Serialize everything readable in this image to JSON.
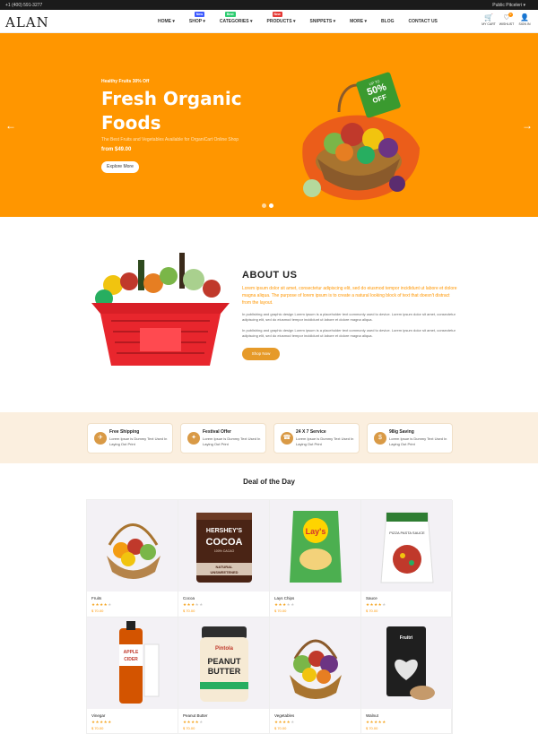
{
  "topbar": {
    "phone": "+1 (400) 591-3277",
    "public_profile": "Public Pitceleri"
  },
  "header": {
    "logo": "ALAN",
    "nav": [
      {
        "label": "HOME",
        "chev": true,
        "badge": null
      },
      {
        "label": "SHOP",
        "chev": true,
        "badge": "New",
        "badge_color": "#3d5afe"
      },
      {
        "label": "CATEGORIES",
        "chev": true,
        "badge": "Best",
        "badge_color": "#2ecc71"
      },
      {
        "label": "PRODUCTS",
        "chev": true,
        "badge": "New",
        "badge_color": "#e53935"
      },
      {
        "label": "SNIPPETS",
        "chev": true,
        "badge": null
      },
      {
        "label": "MORE",
        "chev": true,
        "badge": null
      },
      {
        "label": "BLOG",
        "chev": false,
        "badge": null
      },
      {
        "label": "CONTACT US",
        "chev": false,
        "badge": null
      }
    ],
    "icons": [
      {
        "label": "MY CART",
        "icon": "cart-icon",
        "count": ""
      },
      {
        "label": "WISHLIST",
        "icon": "heart-icon",
        "count": "0"
      },
      {
        "label": "SIGN IN",
        "icon": "user-icon",
        "count": ""
      }
    ]
  },
  "hero": {
    "kicker": "Healthy Fruits 30% Off",
    "title": "Fresh Organic Foods",
    "subtitle": "The Best Fruits and Vegetables Available for OrganiCart Online Shop",
    "price": "from $49.00",
    "button": "Explore More",
    "badge_top": "UP TO",
    "badge_main": "50%",
    "badge_off": "OFF",
    "accent": "#ff9600"
  },
  "about": {
    "title": "ABOUT US",
    "lead": "Lorem ipsum dolor sit amet, consectetur adipiscing elit, sed do eiusmod tempor incididunt ut labore et dolore magna aliqua. The purpose of lorem ipsum is to create a natural looking block of text that doesn't distract from the layout.",
    "para1": "In publishing and graphic design Lorem ipsum is a placeholder text commonly used to device. Lorem ipsum dolor sit amet, consectetur adipiscing elit, sed do eiusmod tempor incididunt ut labore et dolore magna aliqua.",
    "para2": "In publishing and graphic design Lorem ipsum is a placeholder text commonly used to device. Lorem ipsum dolor sit amet, consectetur adipiscing elit, sed do eiusmod tempor incididunt ut labore et dolore magna aliqua.",
    "button": "Shop Now"
  },
  "services": [
    {
      "title": "Free Shipping",
      "desc": "Lorem Ipsue is Dummy Text Used In Laying Out Print",
      "icon": "shipping-icon"
    },
    {
      "title": "Festival Offer",
      "desc": "Lorem Ipsue is Dummy Text Used In Laying Out Print",
      "icon": "offer-icon"
    },
    {
      "title": "24 X 7 Service",
      "desc": "Lorem Ipsue is Dummy Text Used In Laying Out Print",
      "icon": "service-icon"
    },
    {
      "title": "98ig Saving",
      "desc": "Lorem Ipsue is Dummy Text Used In Laying Out Print",
      "icon": "saving-icon"
    }
  ],
  "deal": {
    "title": "Deal of the Day",
    "products": [
      {
        "name": "Fruits",
        "rating": 4,
        "price": "$ 70.00"
      },
      {
        "name": "Cocoa",
        "rating": 3,
        "price": "$ 70.00"
      },
      {
        "name": "Lays Chips",
        "rating": 3,
        "price": "$ 70.00"
      },
      {
        "name": "Sauce",
        "rating": 4,
        "price": "$ 70.00"
      },
      {
        "name": "Vinegar",
        "rating": 5,
        "price": "$ 70.00"
      },
      {
        "name": "Peanut Butter",
        "rating": 4,
        "price": "$ 70.00"
      },
      {
        "name": "Vegetables",
        "rating": 4,
        "price": "$ 70.00"
      },
      {
        "name": "Walnut",
        "rating": 5,
        "price": "$ 70.00"
      }
    ],
    "labels": {
      "hersheys": "HERSHEY'S",
      "cocoa": "COCOA",
      "cocoa_sub": "100% CACAO",
      "natural": "NATURAL",
      "unsweetened": "UNSWEETENED",
      "lays": "Lay's",
      "pintola": "Pintola",
      "peanut": "PEANUT",
      "butter": "BUTTER",
      "apple": "APPLE",
      "cider": "CIDER",
      "pasta": "PIZZA PASTA SAUCE",
      "fruiti": "Fruitri"
    }
  }
}
